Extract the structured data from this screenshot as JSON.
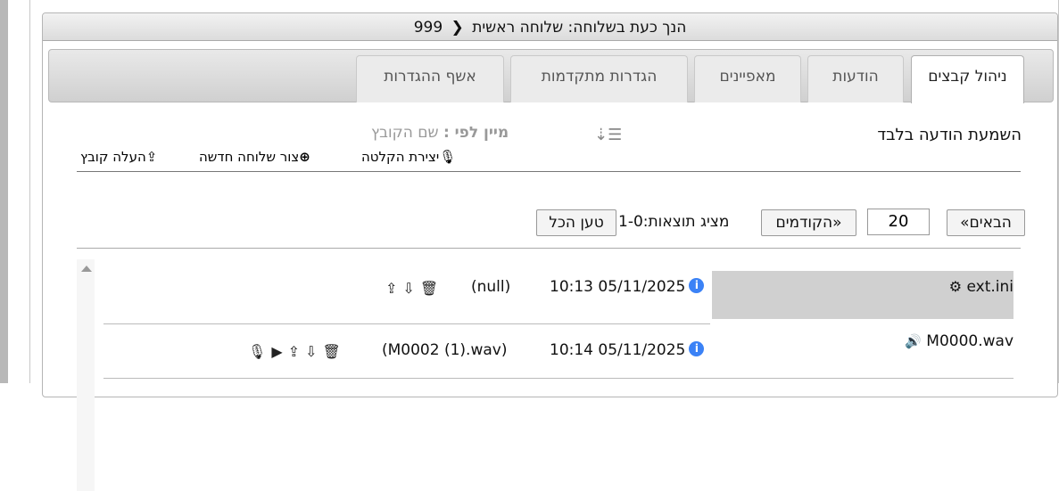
{
  "header": {
    "prefix": "הנך כעת בשלוחה:",
    "main": "שלוחה ראשית",
    "ext": "999"
  },
  "tabs": [
    {
      "label": "ניהול קבצים",
      "active": true
    },
    {
      "label": "הודעות"
    },
    {
      "label": "מאפיינים"
    },
    {
      "label": "הגדרות מתקדמות"
    },
    {
      "label": "אשף ההגדרות"
    }
  ],
  "toolbar": {
    "listen_only": "השמעת הודעה בלבד",
    "sort_label": "מיין לפי :",
    "sort_value": "שם הקובץ",
    "create_recording": "יצירת הקלטה",
    "create_extension": "צור שלוחה חדשה",
    "upload_file": "העלה קובץ"
  },
  "pager": {
    "next": "«הבאים",
    "per_page": "20",
    "prev": "הקודמים»",
    "showing": "מציג תוצאות:1-0",
    "load_all": "טען הכל"
  },
  "files": [
    {
      "name": "ext.ini",
      "icon": "gears-icon",
      "date": "10:13 05/11/2025",
      "ref": "(null)"
    },
    {
      "name": "M0000.wav",
      "icon": "speaker-icon",
      "date": "10:14 05/11/2025",
      "ref": "(M0002 (1).wav)"
    }
  ],
  "colors": {
    "info": "#3b82f6",
    "shaded_row": "#d0d0d0"
  }
}
